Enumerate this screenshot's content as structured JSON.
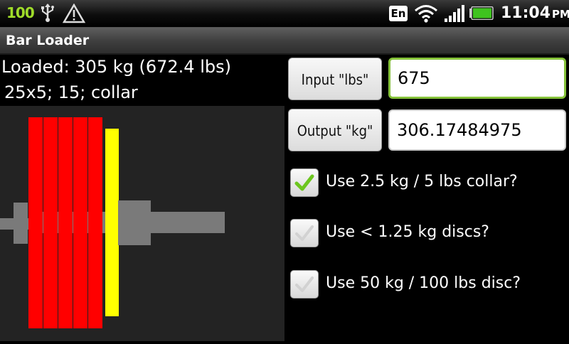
{
  "status_bar": {
    "battery_level": "100",
    "language": "En",
    "time": "11:04",
    "ampm": "PM",
    "icons": [
      "usb-icon",
      "warning-icon",
      "language-icon",
      "wifi-icon",
      "signal-icon",
      "battery-icon"
    ]
  },
  "app": {
    "title": "Bar Loader"
  },
  "summary": {
    "loaded": "Loaded: 305 kg (672.4 lbs)",
    "plates": "25x5; 15; collar"
  },
  "converter": {
    "input_button": "Input \"lbs\"",
    "input_value": "675",
    "output_button": "Output \"kg\"",
    "output_value": "306.17484975"
  },
  "options": [
    {
      "label": "Use 2.5 kg / 5 lbs collar?",
      "checked": true
    },
    {
      "label": "Use < 1.25 kg discs?",
      "checked": false
    },
    {
      "label": "Use 50 kg / 100 lbs disc?",
      "checked": false
    }
  ],
  "bar_graphic": {
    "plates": [
      {
        "weight": "25",
        "color": "#ff0000"
      },
      {
        "weight": "25",
        "color": "#ff0000"
      },
      {
        "weight": "25",
        "color": "#ff0000"
      },
      {
        "weight": "25",
        "color": "#ff0000"
      },
      {
        "weight": "25",
        "color": "#ff0000"
      },
      {
        "weight": "15",
        "color": "#ffff00"
      }
    ],
    "bar_color": "#7a7a7a"
  },
  "colors": {
    "accent": "#86c33a",
    "check": "#6cc61e"
  }
}
